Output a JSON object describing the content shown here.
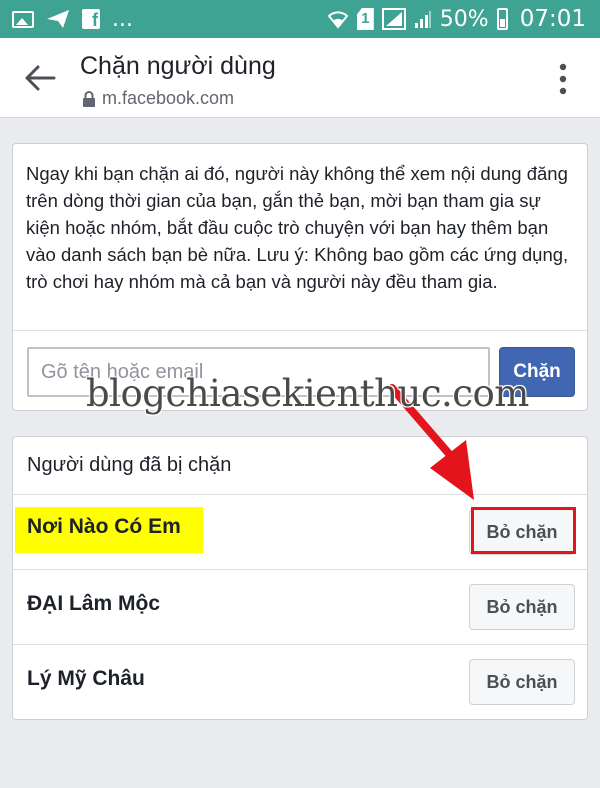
{
  "status_bar": {
    "ellipsis": "...",
    "sim_badge": "1",
    "battery": "50%",
    "time": "07:01"
  },
  "app_bar": {
    "title": "Chặn người dùng",
    "url": "m.facebook.com"
  },
  "block_form": {
    "description": "Ngay khi bạn chặn ai đó, người này không thể xem nội dung đăng trên dòng thời gian của bạn, gắn thẻ bạn, mời bạn tham gia sự kiện hoặc nhóm, bắt đầu cuộc trò chuyện với bạn hay thêm bạn vào danh sách bạn bè nữa. Lưu ý: Không bao gồm các ứng dụng, trò chơi hay nhóm mà cả bạn và người này đều tham gia.",
    "input_placeholder": "Gõ tên hoặc email",
    "block_button": "Chặn"
  },
  "blocked_list": {
    "title": "Người dùng đã bị chặn",
    "unblock_label": "Bỏ chặn",
    "users": [
      {
        "name": "Nơi Nào Có Em",
        "highlighted": true
      },
      {
        "name": "ĐẠI Lâm Mộc",
        "highlighted": false
      },
      {
        "name": "Lý Mỹ Châu",
        "highlighted": false
      }
    ]
  },
  "watermark": "blogchiasekienthuc.com",
  "colors": {
    "status_bar": "#3ea392",
    "facebook_blue": "#4267b2",
    "highlight": "#ffff00",
    "annotation_red": "#e3141b"
  }
}
